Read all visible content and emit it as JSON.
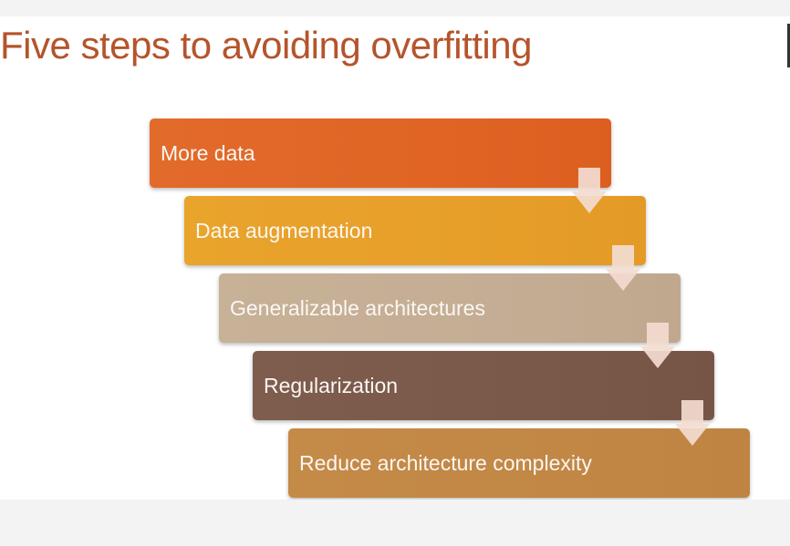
{
  "title": "Five steps to avoiding overfitting",
  "steps": [
    {
      "label": "More data"
    },
    {
      "label": "Data augmentation"
    },
    {
      "label": "Generalizable architectures"
    },
    {
      "label": "Regularization"
    },
    {
      "label": "Reduce architecture complexity"
    }
  ],
  "colors": {
    "title": "#b5542b",
    "step1": "#e0652a",
    "step2": "#e8a12b",
    "step3": "#c4ad94",
    "step4": "#7b594a",
    "step5": "#c28745",
    "arrow": "#f3dcd0"
  }
}
